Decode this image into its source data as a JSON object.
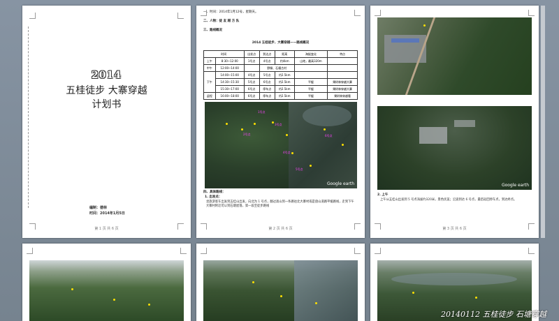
{
  "cover": {
    "year": "2014",
    "title": "五桂徒步 大寨穿越",
    "subtitle": "计划书",
    "editor": "编制：德林",
    "date": "时间：2014年1月5日",
    "footer": "第 1 页 共 6 页"
  },
  "page2": {
    "item1": "一、时间：2014年1月12号，星期天。",
    "item2": "二、人物：徒 友 越 方 队",
    "item3": "三、路线概况",
    "table_title": "2014 五桂徒步、大寨穿越——路线概况",
    "headers": [
      "时间",
      "出发点",
      "到达点",
      "距离",
      "海拔变化",
      "特点"
    ],
    "rows": [
      [
        "上午",
        "8:30~12:00",
        "1号点",
        "4号点",
        "约4km",
        "山地，最高320m",
        ""
      ],
      [
        "中午",
        "12:00~14:00",
        "",
        "野餐、石塘古村",
        "",
        "",
        ""
      ],
      [
        "",
        "14:00~15:00",
        "4号点",
        "5号点",
        "约2.5km",
        "",
        ""
      ],
      [
        "下午",
        "14:30~15:30",
        "5号点",
        "6号点",
        "约2.5km",
        "平缓",
        "果树林穿越大寨"
      ],
      [
        "",
        "15:30~17:00",
        "6号点",
        "停车点",
        "约2.5km",
        "平缓",
        "果树林穿越大寨"
      ],
      [
        "返程",
        "16:00~18:00",
        "6号点",
        "停车点",
        "约2.5km",
        "平缓",
        "果树林穿越看"
      ]
    ],
    "section4": "四、具体路线：",
    "sub1": "1. 出发点：",
    "para": "坐旅游客车出发到五桂山出发，向北为 1 号点，翻过高山到一条路往北大寨村或是盘山道路平缓路线，走到下午大寨村附近可以到石塘屋落，第一段至徒步路线",
    "footer": "第 2 页 共 6 页"
  },
  "page3": {
    "item": "2. 上午",
    "para": "上午从五桂山出发到 5 号点海拔约320米，景色优美；沿途到达 6 号点，最后返回停车点，到达终点。",
    "footer": "第 3 页 共 6 页",
    "watermark": "Google earth"
  },
  "page2_watermark": "Google earth",
  "map_labels": [
    "1号点",
    "2号点",
    "3号点",
    "4号点",
    "5号点",
    "6号点"
  ],
  "caption": "20140112 五桂徒步 石塘穿越"
}
